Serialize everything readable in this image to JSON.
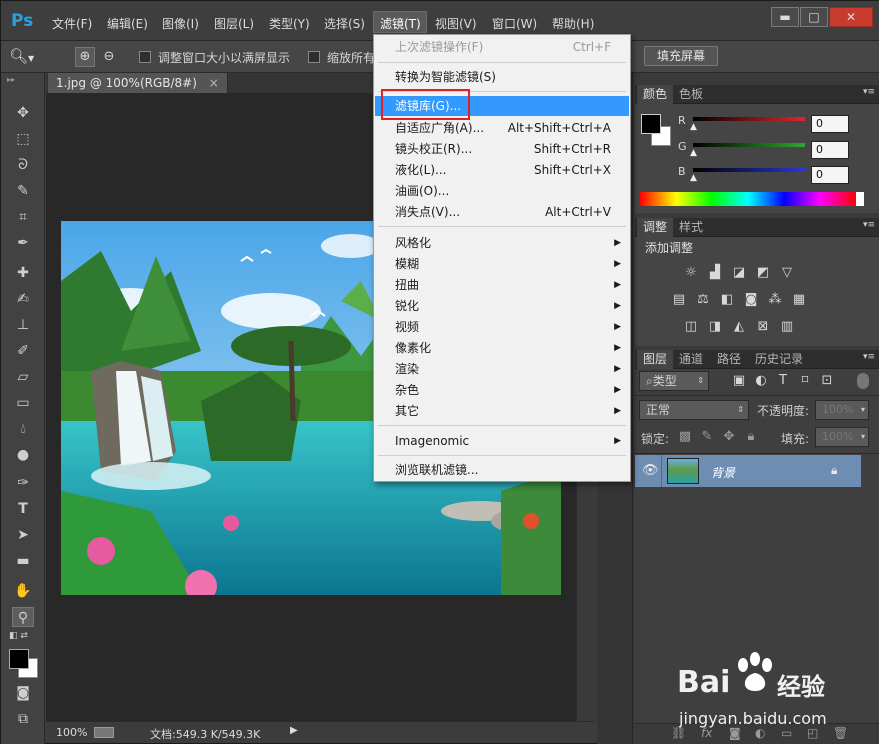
{
  "app": {
    "logo": "Ps"
  },
  "menubar": {
    "items": [
      "文件(F)",
      "编辑(E)",
      "图像(I)",
      "图层(L)",
      "类型(Y)",
      "选择(S)",
      "滤镜(T)",
      "视图(V)",
      "窗口(W)",
      "帮助(H)"
    ],
    "active": "滤镜(T)"
  },
  "window_buttons": {
    "minimize": "▬",
    "maximize": "□",
    "close": "✕"
  },
  "optionsbar": {
    "resize_windows_label": "调整窗口大小以满屏显示",
    "zoom_all_label": "缩放所有",
    "fill_screen_label": "填充屏幕"
  },
  "document": {
    "tab_title": "1.jpg @ 100%(RGB/8#)",
    "tab_close": "×"
  },
  "statusbar": {
    "zoom": "100%",
    "doc_info": "文档:549.3 K/549.3K"
  },
  "filter_menu": {
    "last_filter": {
      "label": "上次滤镜操作(F)",
      "shortcut": "Ctrl+F"
    },
    "convert_smart": "转换为智能滤镜(S)",
    "items": [
      {
        "label": "滤镜库(G)...",
        "shortcut": ""
      },
      {
        "label": "自适应广角(A)...",
        "shortcut": "Alt+Shift+Ctrl+A"
      },
      {
        "label": "镜头校正(R)...",
        "shortcut": "Shift+Ctrl+R"
      },
      {
        "label": "液化(L)...",
        "shortcut": "Shift+Ctrl+X"
      },
      {
        "label": "油画(O)...",
        "shortcut": ""
      },
      {
        "label": "消失点(V)...",
        "shortcut": "Alt+Ctrl+V"
      }
    ],
    "submenus": [
      "风格化",
      "模糊",
      "扭曲",
      "锐化",
      "视频",
      "像素化",
      "渲染",
      "杂色",
      "其它"
    ],
    "plugin": "Imagenomic",
    "browse_online": "浏览联机滤镜..."
  },
  "color_panel": {
    "tabs": [
      "颜色",
      "色板"
    ],
    "channels": [
      {
        "label": "R",
        "value": "0",
        "color": "#e0262b"
      },
      {
        "label": "G",
        "value": "0",
        "color": "#2fa630"
      },
      {
        "label": "B",
        "value": "0",
        "color": "#2a36d8"
      }
    ]
  },
  "adjust_panel": {
    "tabs": [
      "调整",
      "样式"
    ],
    "title": "添加调整"
  },
  "layers_panel": {
    "tabs": [
      "图层",
      "通道",
      "路径",
      "历史记录"
    ],
    "filter_kind": "类型",
    "blend_mode": "正常",
    "opacity_label": "不透明度:",
    "opacity_value": "100%",
    "lock_label": "锁定:",
    "fill_label": "填充:",
    "fill_value": "100%",
    "layers": [
      {
        "name": "背景",
        "visible": true,
        "locked": true
      }
    ]
  },
  "watermark": {
    "brand": "Bai",
    "brand_cn": "经验",
    "url": "jingyan.baidu.com"
  }
}
